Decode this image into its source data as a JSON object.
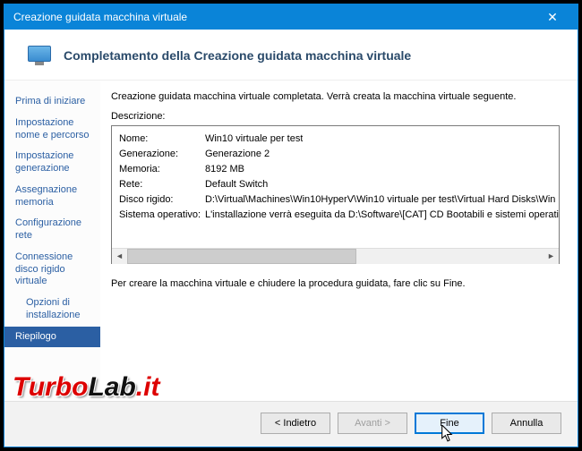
{
  "window": {
    "title": "Creazione guidata macchina virtuale",
    "close_glyph": "✕"
  },
  "header": {
    "title": "Completamento della Creazione guidata macchina virtuale"
  },
  "sidebar": {
    "steps": [
      "Prima di iniziare",
      "Impostazione nome e percorso",
      "Impostazione generazione",
      "Assegnazione memoria",
      "Configurazione rete",
      "Connessione disco rigido virtuale",
      "Opzioni di installazione",
      "Riepilogo"
    ],
    "active_index": 7,
    "sub_index": 6
  },
  "content": {
    "intro": "Creazione guidata macchina virtuale completata. Verrà creata la macchina virtuale seguente.",
    "desc_label": "Descrizione:",
    "rows": [
      {
        "k": "Nome:",
        "v": "Win10 virtuale per test"
      },
      {
        "k": "Generazione:",
        "v": "Generazione 2"
      },
      {
        "k": "Memoria:",
        "v": "8192 MB"
      },
      {
        "k": "Rete:",
        "v": "Default Switch"
      },
      {
        "k": "Disco rigido:",
        "v": "D:\\Virtual\\Machines\\Win10HyperV\\Win10 virtuale per test\\Virtual Hard Disks\\Win"
      },
      {
        "k": "Sistema operativo:",
        "v": "L'installazione verrà eseguita da D:\\Software\\[CAT] CD Bootabili e sistemi operati"
      }
    ],
    "closing": "Per creare la macchina virtuale e chiudere la procedura guidata, fare clic su Fine."
  },
  "footer": {
    "back": "< Indietro",
    "next": "Avanti >",
    "finish": "Fine",
    "cancel": "Annulla"
  },
  "watermark": {
    "part1": "Turbo",
    "part2": "Lab",
    "part3": ".it"
  }
}
